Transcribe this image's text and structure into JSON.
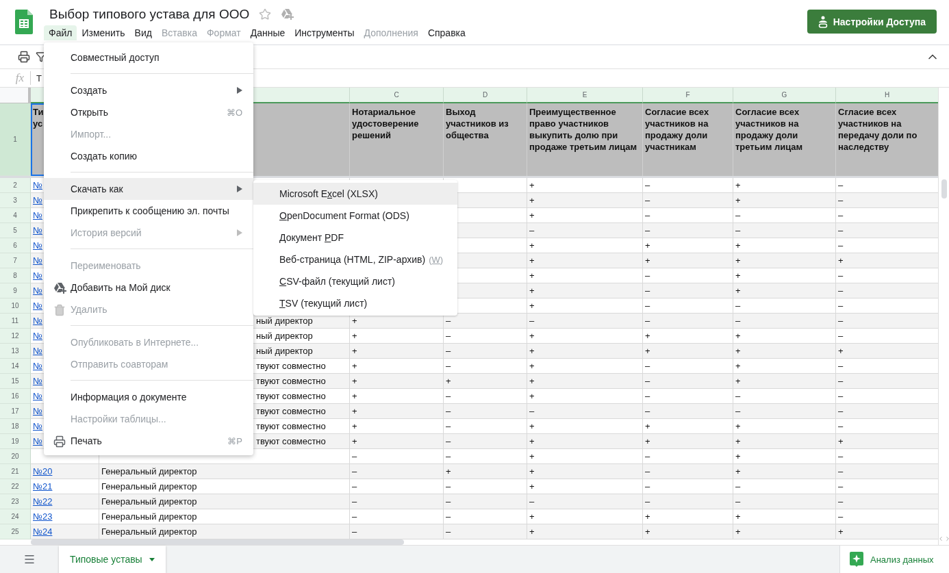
{
  "app": {
    "title": "Выбор типового устава для ООО"
  },
  "menubar": [
    {
      "label": "Файл",
      "selected": true,
      "disabled": false
    },
    {
      "label": "Изменить",
      "selected": false,
      "disabled": false
    },
    {
      "label": "Вид",
      "selected": false,
      "disabled": false
    },
    {
      "label": "Вставка",
      "selected": false,
      "disabled": true
    },
    {
      "label": "Формат",
      "selected": false,
      "disabled": true
    },
    {
      "label": "Данные",
      "selected": false,
      "disabled": false
    },
    {
      "label": "Инструменты",
      "selected": false,
      "disabled": false
    },
    {
      "label": "Дополнения",
      "selected": false,
      "disabled": true
    },
    {
      "label": "Справка",
      "selected": false,
      "disabled": false
    }
  ],
  "share_button": {
    "label": "Настройки Доступа"
  },
  "formula_bar": {
    "label": "fx",
    "value": "Т"
  },
  "columns": [
    {
      "letter": "C"
    },
    {
      "letter": "D"
    },
    {
      "letter": "E"
    },
    {
      "letter": "F"
    },
    {
      "letter": "G"
    },
    {
      "letter": "H"
    }
  ],
  "header_row": {
    "number": "1",
    "a": "Ти\nус",
    "c": "Нотариальное удостоверение решений",
    "d": "Выход участников из общества",
    "e": "Преимущественное право участников выкупить долю при продаже третьим лицам",
    "f": "Согласие всех участников на продажу доли участникам",
    "g": "Согласие всех участников на продажу доли третьим лицам",
    "h": "Сгласие всех участников на передачу доли по наследству"
  },
  "rows": [
    {
      "number": "2",
      "a": "№",
      "e": "+",
      "f": "–",
      "g": "+",
      "h": "–"
    },
    {
      "number": "3",
      "a": "№",
      "e": "+",
      "f": "–",
      "g": "+",
      "h": "–"
    },
    {
      "number": "4",
      "a": "№",
      "e": "+",
      "f": "–",
      "g": "–",
      "h": "–"
    },
    {
      "number": "5",
      "a": "№",
      "e": "–",
      "f": "–",
      "g": "–",
      "h": "–"
    },
    {
      "number": "6",
      "a": "№",
      "e": "+",
      "f": "+",
      "g": "+",
      "h": "–"
    },
    {
      "number": "7",
      "a": "№",
      "e": "+",
      "f": "+",
      "g": "+",
      "h": "+"
    },
    {
      "number": "8",
      "a": "№",
      "e": "+",
      "f": "–",
      "g": "+",
      "h": "–"
    },
    {
      "number": "9",
      "a": "№",
      "e": "+",
      "f": "–",
      "g": "+",
      "h": "–"
    },
    {
      "number": "10",
      "a": "№",
      "e": "+",
      "f": "–",
      "g": "–",
      "h": "–"
    },
    {
      "number": "11",
      "a": "№",
      "b_tail": "ный директор",
      "c": "+",
      "d": "–",
      "e": "–",
      "f": "–",
      "g": "–",
      "h": "–"
    },
    {
      "number": "12",
      "a": "№",
      "b_tail": "ный директор",
      "c": "+",
      "d": "–",
      "e": "+",
      "f": "+",
      "g": "+",
      "h": "–"
    },
    {
      "number": "13",
      "a": "№",
      "b_tail": "ный директор",
      "c": "+",
      "d": "–",
      "e": "+",
      "f": "+",
      "g": "+",
      "h": "+"
    },
    {
      "number": "14",
      "a": "№",
      "b_tail": "твуют совместно",
      "c": "+",
      "d": "–",
      "e": "+",
      "f": "–",
      "g": "+",
      "h": "–"
    },
    {
      "number": "15",
      "a": "№",
      "b_tail": "твуют совместно",
      "c": "+",
      "d": "+",
      "e": "+",
      "f": "–",
      "g": "+",
      "h": "–"
    },
    {
      "number": "16",
      "a": "№",
      "b_tail": "твуют совместно",
      "c": "+",
      "d": "–",
      "e": "+",
      "f": "–",
      "g": "–",
      "h": "–"
    },
    {
      "number": "17",
      "a": "№",
      "b_tail": "твуют совместно",
      "c": "+",
      "d": "–",
      "e": "–",
      "f": "–",
      "g": "–",
      "h": "–"
    },
    {
      "number": "18",
      "a": "№",
      "b_tail": "твуют совместно",
      "c": "+",
      "d": "–",
      "e": "+",
      "f": "+",
      "g": "+",
      "h": "–"
    },
    {
      "number": "19",
      "a": "№",
      "b_tail": "твуют совместно",
      "c": "+",
      "d": "–",
      "e": "+",
      "f": "+",
      "g": "+",
      "h": "+"
    },
    {
      "number": "20",
      "c": "–",
      "d": "–",
      "e": "+",
      "f": "–",
      "g": "+",
      "h": "–"
    },
    {
      "number": "21",
      "a": "№20",
      "b": "Генеральный директор",
      "c": "–",
      "d": "+",
      "e": "+",
      "f": "–",
      "g": "+",
      "h": "–"
    },
    {
      "number": "22",
      "a": "№21",
      "b": "Генеральный директор",
      "c": "–",
      "d": "–",
      "e": "+",
      "f": "–",
      "g": "–",
      "h": "–"
    },
    {
      "number": "23",
      "a": "№22",
      "b": "Генеральный директор",
      "c": "–",
      "d": "–",
      "e": "–",
      "f": "–",
      "g": "–",
      "h": "–"
    },
    {
      "number": "24",
      "a": "№23",
      "b": "Генеральный директор",
      "c": "–",
      "d": "–",
      "e": "+",
      "f": "+",
      "g": "+",
      "h": "–"
    },
    {
      "number": "25",
      "a": "№24",
      "b": "Генеральный директор",
      "c": "–",
      "d": "–",
      "e": "+",
      "f": "+",
      "g": "+",
      "h": "+"
    }
  ],
  "file_menu": {
    "items": [
      {
        "kind": "item",
        "label": "Совместный доступ",
        "disabled": false,
        "selected": false
      },
      {
        "kind": "separator"
      },
      {
        "kind": "item",
        "label": "Создать",
        "disabled": false,
        "selected": false,
        "submenu": true
      },
      {
        "kind": "item",
        "label": "Открыть",
        "disabled": false,
        "selected": false,
        "shortcut": "⌘O"
      },
      {
        "kind": "item",
        "label": "Импорт...",
        "disabled": true,
        "selected": false
      },
      {
        "kind": "item",
        "label": "Создать копию",
        "disabled": false,
        "selected": false
      },
      {
        "kind": "separator"
      },
      {
        "kind": "item",
        "label": "Скачать как",
        "disabled": false,
        "selected": true,
        "submenu": true
      },
      {
        "kind": "item",
        "label": "Прикрепить к сообщению эл. почты",
        "disabled": false,
        "selected": false
      },
      {
        "kind": "item",
        "label": "История версий",
        "disabled": true,
        "selected": false,
        "submenu": true
      },
      {
        "kind": "separator"
      },
      {
        "kind": "item",
        "label": "Переименовать",
        "disabled": true,
        "selected": false
      },
      {
        "kind": "item",
        "label": "Добавить на Мой диск",
        "disabled": false,
        "selected": false
      },
      {
        "kind": "item",
        "label": "Удалить",
        "disabled": true,
        "selected": false
      },
      {
        "kind": "separator"
      },
      {
        "kind": "item",
        "label": "Опубликовать в Интернете...",
        "disabled": true,
        "selected": false
      },
      {
        "kind": "item",
        "label": "Отправить соавторам",
        "disabled": true,
        "selected": false
      },
      {
        "kind": "separator"
      },
      {
        "kind": "item",
        "label": "Информация о документе",
        "disabled": false,
        "selected": false
      },
      {
        "kind": "item",
        "label": "Настройки таблицы...",
        "disabled": true,
        "selected": false
      },
      {
        "kind": "item",
        "label": "Печать",
        "disabled": false,
        "selected": false,
        "shortcut": "⌘P"
      }
    ]
  },
  "download_submenu": {
    "items": [
      {
        "before": "Microsoft E",
        "key": "x",
        "after": "cel (XLSX)",
        "selected": true
      },
      {
        "key": "O",
        "after": "penDocument Format (ODS)",
        "selected": false
      },
      {
        "before": "Документ ",
        "key": "P",
        "after": "DF",
        "selected": false
      },
      {
        "before": "Веб-страница (HTML, ZIP-архив)",
        "hint": {
          "before": "(",
          "key": "W",
          "after": ")"
        },
        "selected": false
      },
      {
        "key": "C",
        "after": "SV-файл (текущий лист)",
        "selected": false
      },
      {
        "key": "T",
        "after": "SV (текущий лист)",
        "selected": false
      }
    ]
  },
  "sheet_tabs": [
    {
      "label": "Типовые уставы",
      "selected": true
    }
  ],
  "explore_button": {
    "label": "Анализ данных"
  }
}
